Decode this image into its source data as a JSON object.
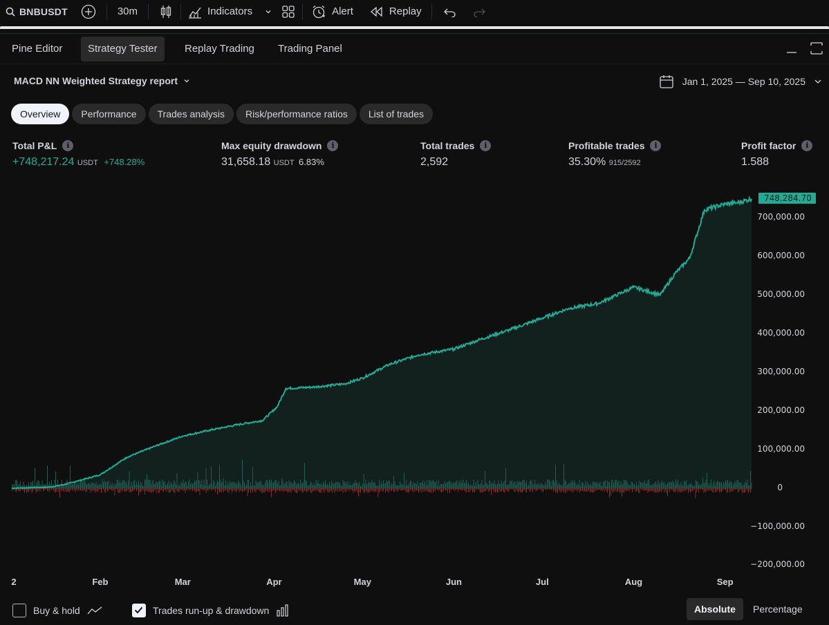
{
  "toolbar": {
    "symbol": "BNBUSDT",
    "interval": "30m",
    "indicators": "Indicators",
    "alert": "Alert",
    "replay": "Replay"
  },
  "panel_tabs": [
    "Pine Editor",
    "Strategy Tester",
    "Replay Trading",
    "Trading Panel"
  ],
  "active_panel_tab": "Strategy Tester",
  "report": {
    "title": "MACD NN Weighted Strategy report",
    "date_range": "Jan 1, 2025 — Sep 10, 2025"
  },
  "subtabs": [
    "Overview",
    "Performance",
    "Trades analysis",
    "Risk/performance ratios",
    "List of trades"
  ],
  "active_subtab": "Overview",
  "metrics": {
    "total_pl": {
      "label": "Total P&L",
      "value": "+748,217.24",
      "unit": "USDT",
      "pct": "+748.28%"
    },
    "max_dd": {
      "label": "Max equity drawdown",
      "value": "31,658.18",
      "unit": "USDT",
      "pct": "6.83%"
    },
    "total_trades": {
      "label": "Total trades",
      "value": "2,592"
    },
    "profitable": {
      "label": "Profitable trades",
      "value": "35.30%",
      "ratio": "915/2592"
    },
    "profit_factor": {
      "label": "Profit factor",
      "value": "1.588"
    }
  },
  "colors": {
    "equity": "#22ab94",
    "runup": "#1d5e52",
    "drawdown": "#8b2a2a",
    "background": "#0f0f0f"
  },
  "chart_data": {
    "type": "area",
    "series": [
      {
        "name": "",
        "x": [
          "Jan 2",
          "Jan 15",
          "Jan 20",
          "Jan 25",
          "Feb 1",
          "Feb 10",
          "Feb 20",
          "Mar 1",
          "Mar 10",
          "Mar 20",
          "Mar 28",
          "Apr 2",
          "Apr 5",
          "Apr 15",
          "Apr 25",
          "May 1",
          "May 10",
          "May 20",
          "Jun 1",
          "Jun 10",
          "Jun 20",
          "Jul 1",
          "Jul 10",
          "Jul 20",
          "Aug 1",
          "Aug 10",
          "Aug 15",
          "Aug 20",
          "Aug 25",
          "Sep 1",
          "Sep 5",
          "Sep 10"
        ],
        "values": [
          0,
          3000,
          10000,
          20000,
          35000,
          80000,
          110000,
          135000,
          150000,
          165000,
          175000,
          210000,
          258000,
          262000,
          270000,
          285000,
          320000,
          345000,
          360000,
          385000,
          410000,
          440000,
          465000,
          478000,
          520000,
          500000,
          555000,
          595000,
          720000,
          735000,
          738000,
          748284.7
        ]
      }
    ],
    "x_ticks": [
      "2",
      "Feb",
      "Mar",
      "Apr",
      "May",
      "Jun",
      "Jul",
      "Aug",
      "Sep"
    ],
    "y_ticks": [
      "700,000.00",
      "600,000.00",
      "500,000.00",
      "400,000.00",
      "300,000.00",
      "200,000.00",
      "100,000.00",
      "0",
      "−100,000.00",
      "−200,000.00"
    ],
    "ylim": [
      -200000,
      748284.7
    ],
    "last_value": "748,284.70"
  },
  "bottom": {
    "buy_hold": "Buy & hold",
    "buy_hold_checked": false,
    "runup_drawdown": "Trades run-up & drawdown",
    "runup_checked": true,
    "absolute": "Absolute",
    "percentage": "Percentage",
    "active_mode": "Absolute"
  }
}
